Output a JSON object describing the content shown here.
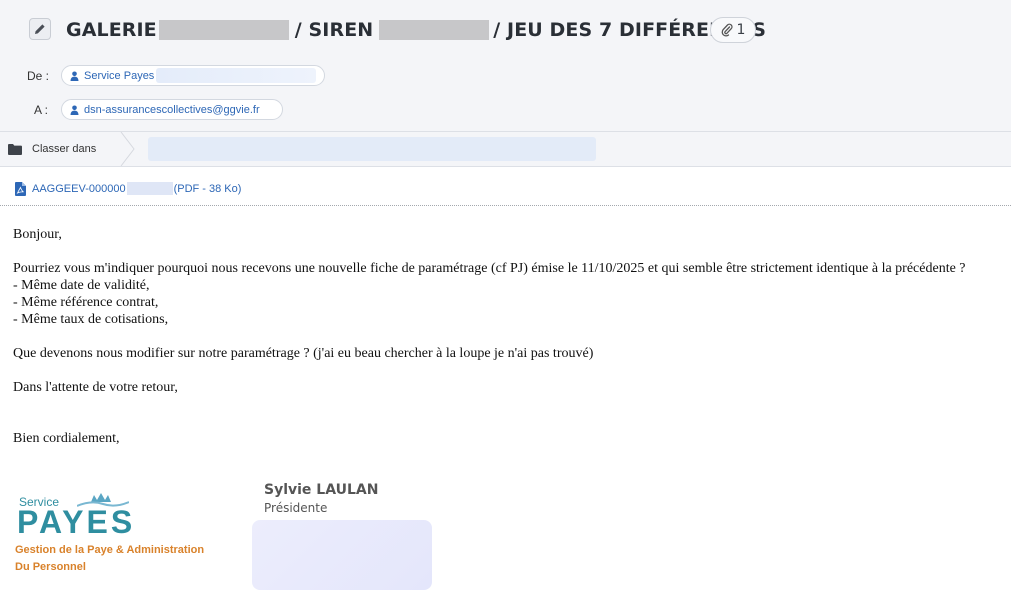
{
  "header": {
    "subject_prefix": "GALERIE",
    "subject_mid": "/ SIREN",
    "subject_suffix": "/ JEU DES 7 DIFFÉRENCES",
    "attachment_count": "1",
    "from_label": "De :",
    "from_value": "Service Payes",
    "to_label": "A :",
    "to_value": "dsn-assurancescollectives@ggvie.fr"
  },
  "classer": {
    "label": "Classer dans"
  },
  "attachment": {
    "name_prefix": "AAGGEEV-000000",
    "name_suffix": "(PDF - 38 Ko)"
  },
  "body": {
    "lines": [
      "Bonjour,",
      "Pourriez vous m'indiquer pourquoi nous recevons une nouvelle fiche de paramétrage (cf PJ) émise le 11/10/2025 et qui semble être strictement identique à la précédente ?",
      "- Même date de validité,",
      "- Même référence contrat,",
      "- Même taux de cotisations,",
      "Que devenons nous modifier sur notre paramétrage ? (j'ai eu beau chercher à la loupe je n'ai pas trouvé)",
      "Dans l'attente de votre retour,",
      "Bien cordialement,"
    ]
  },
  "signature": {
    "logo_small": "Service",
    "logo_big": "PAYES",
    "logo_tagline_1": "Gestion de la Paye & Administration",
    "logo_tagline_2": "Du Personnel",
    "name": "Sylvie LAULAN",
    "role": "Présidente"
  },
  "colors": {
    "link": "#2d67b6",
    "header_bg": "#f4f5f8",
    "logo_teal": "#2f8ea0",
    "logo_orange": "#d9822b",
    "pdf_icon": "#2d67b6"
  },
  "icons": [
    "pencil-icon",
    "paperclip-icon",
    "user-icon",
    "folder-icon",
    "pdf-icon",
    "crown-icon"
  ]
}
